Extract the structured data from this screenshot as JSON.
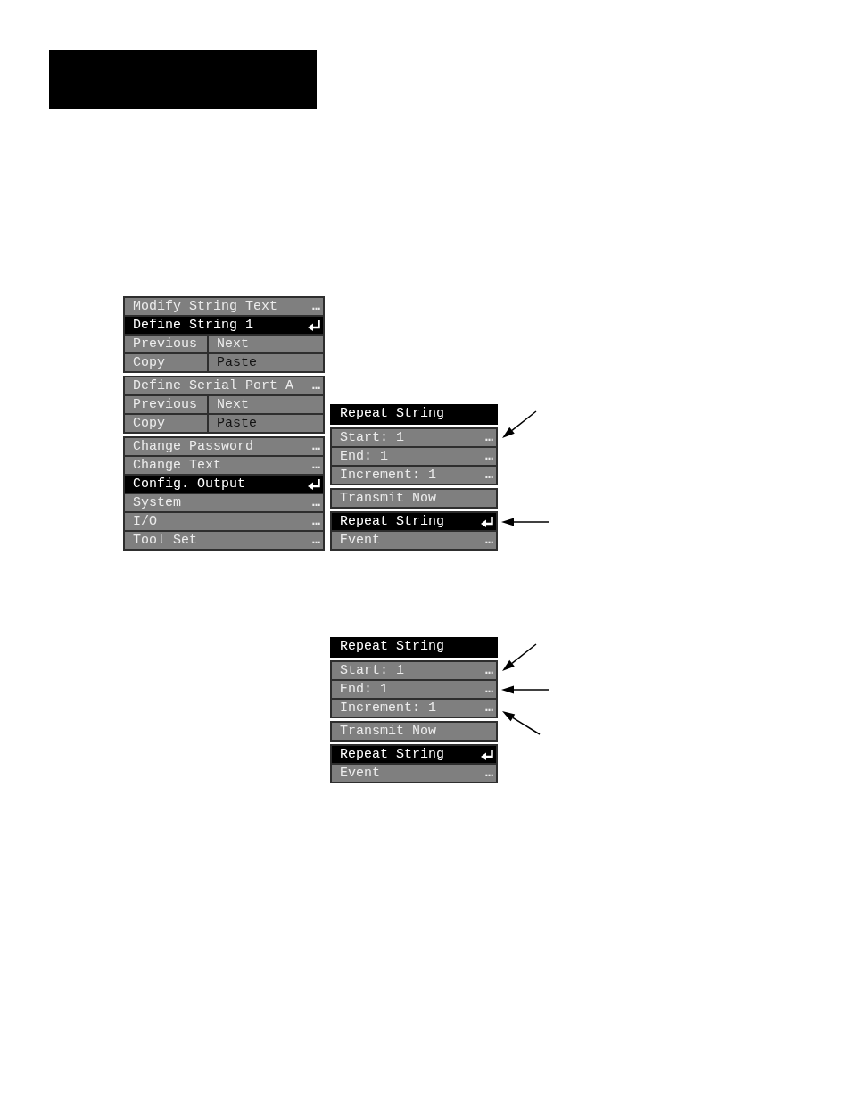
{
  "figures": [
    {
      "menus": [
        {
          "groups": [
            {
              "items": [
                {
                  "kind": "more",
                  "label": "Modify String Text",
                  "suffix": "…",
                  "selected": false
                },
                {
                  "kind": "enter",
                  "label": "Define String 1",
                  "selected": true
                },
                {
                  "kind": "split",
                  "cells": [
                    {
                      "label": "Previous",
                      "selected": false,
                      "disabled": false
                    },
                    {
                      "label": "Next",
                      "selected": false,
                      "disabled": false
                    }
                  ]
                },
                {
                  "kind": "split",
                  "cells": [
                    {
                      "label": "Copy",
                      "selected": false,
                      "disabled": false
                    },
                    {
                      "label": "Paste",
                      "selected": false,
                      "disabled": true
                    }
                  ]
                }
              ]
            },
            {
              "items": [
                {
                  "kind": "more",
                  "label": "Define Serial Port A",
                  "suffix": "…",
                  "selected": false
                },
                {
                  "kind": "split",
                  "cells": [
                    {
                      "label": "Previous",
                      "selected": false,
                      "disabled": false
                    },
                    {
                      "label": "Next",
                      "selected": false,
                      "disabled": false
                    }
                  ]
                },
                {
                  "kind": "split",
                  "cells": [
                    {
                      "label": "Copy",
                      "selected": false,
                      "disabled": false
                    },
                    {
                      "label": "Paste",
                      "selected": false,
                      "disabled": true
                    }
                  ]
                }
              ]
            },
            {
              "items": [
                {
                  "kind": "more",
                  "label": "Change Password",
                  "suffix": "…",
                  "selected": false
                },
                {
                  "kind": "more",
                  "label": "Change Text",
                  "suffix": "…",
                  "selected": false
                },
                {
                  "kind": "enter",
                  "label": "Config. Output",
                  "selected": true
                },
                {
                  "kind": "more",
                  "label": "System",
                  "suffix": "…",
                  "selected": false
                },
                {
                  "kind": "more",
                  "label": "I/O",
                  "suffix": "…",
                  "selected": false
                },
                {
                  "kind": "more",
                  "label": "Tool Set",
                  "suffix": "…",
                  "selected": false
                }
              ]
            }
          ]
        },
        {
          "title": "Repeat String",
          "groups": [
            {
              "items": [
                {
                  "kind": "more",
                  "label": "Start: 1",
                  "suffix": "…",
                  "selected": false,
                  "callout": {
                    "kind": "diagonal_down"
                  }
                },
                {
                  "kind": "more",
                  "label": "End: 1",
                  "suffix": "…",
                  "selected": false
                },
                {
                  "kind": "more",
                  "label": "Increment: 1",
                  "suffix": "…",
                  "selected": false
                }
              ]
            },
            {
              "items": [
                {
                  "kind": "plain",
                  "label": "Transmit Now",
                  "selected": false
                }
              ]
            },
            {
              "items": [
                {
                  "kind": "enter",
                  "label": "Repeat String",
                  "selected": true,
                  "callout": {
                    "kind": "level"
                  }
                },
                {
                  "kind": "more",
                  "label": "Event",
                  "suffix": "…",
                  "selected": false
                }
              ]
            }
          ]
        }
      ]
    },
    {
      "menus": [
        {
          "title": "Repeat String",
          "groups": [
            {
              "items": [
                {
                  "kind": "more",
                  "label": "Start: 1",
                  "suffix": "…",
                  "selected": false,
                  "callout": {
                    "kind": "diagonal_down"
                  }
                },
                {
                  "kind": "more",
                  "label": "End: 1",
                  "suffix": "…",
                  "selected": false,
                  "callout": {
                    "kind": "level"
                  }
                },
                {
                  "kind": "more",
                  "label": "Increment: 1",
                  "suffix": "…",
                  "selected": false,
                  "callout": {
                    "kind": "diagonal_up"
                  }
                }
              ]
            },
            {
              "items": [
                {
                  "kind": "plain",
                  "label": "Transmit Now",
                  "selected": false
                }
              ]
            },
            {
              "items": [
                {
                  "kind": "enter",
                  "label": "Repeat String",
                  "selected": true
                },
                {
                  "kind": "more",
                  "label": "Event",
                  "suffix": "…",
                  "selected": false
                }
              ]
            }
          ]
        }
      ]
    }
  ]
}
